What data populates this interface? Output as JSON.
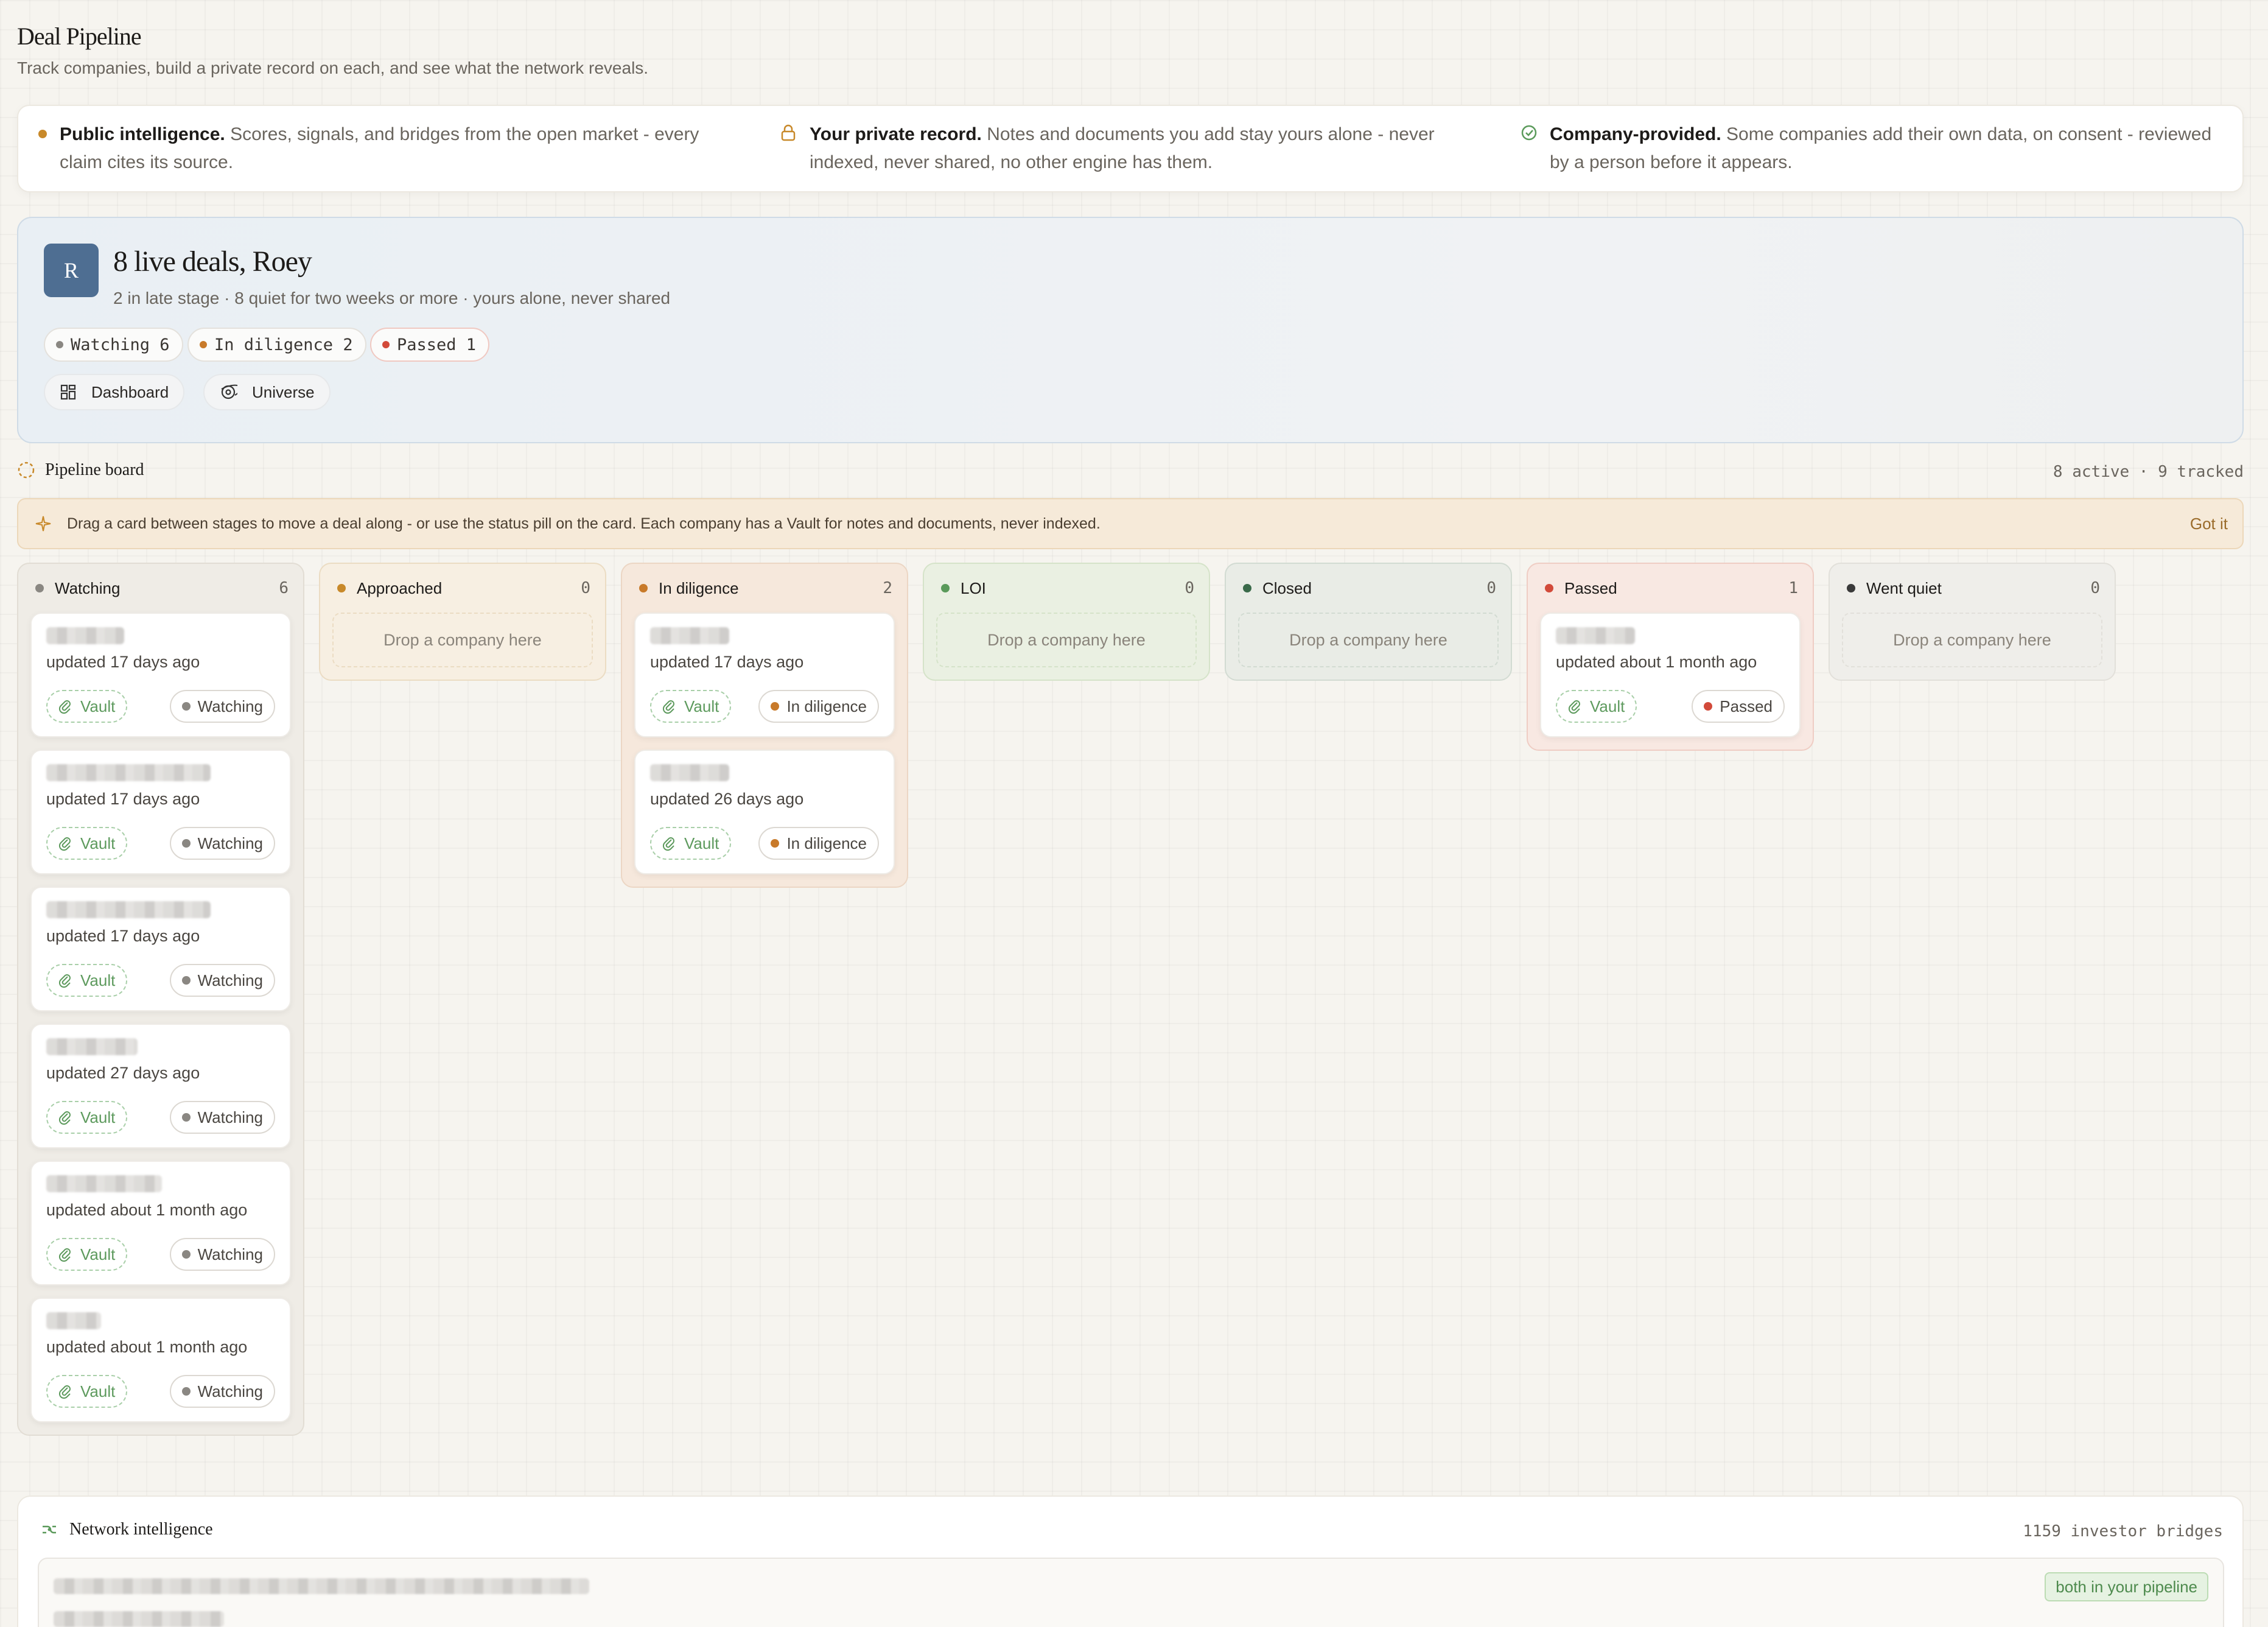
{
  "page": {
    "title": "Deal Pipeline",
    "subtitle": "Track companies, build a private record on each, and see what the network reveals."
  },
  "info": {
    "public": {
      "title": "Public intelligence.",
      "text": " Scores, signals, and bridges from the open market - every claim cites its source."
    },
    "private": {
      "title": "Your private record.",
      "text": " Notes and documents you add stay yours alone - never indexed, never shared, no other engine has them."
    },
    "company": {
      "title": "Company-provided.",
      "text": " Some companies add their own data, on consent - reviewed by a person before it appears."
    }
  },
  "hero": {
    "avatar": "R",
    "title": "8 live deals, Roey",
    "subtitle": "2 in late stage · 8 quiet for two weeks or more · yours alone, never shared",
    "chips": [
      {
        "label": "Watching 6",
        "color": "#8a8782"
      },
      {
        "label": "In diligence 2",
        "color": "#c87a2a"
      },
      {
        "label": "Passed 1",
        "color": "#d24a3a"
      }
    ],
    "buttons": {
      "dashboard": "Dashboard",
      "universe": "Universe"
    }
  },
  "board": {
    "label": "Pipeline board",
    "count": "8 active · 9 tracked",
    "tip": "Drag a card between stages to move a deal along - or use the status pill on the card. Each company has a Vault for notes and documents, never indexed.",
    "tip_dismiss": "Got it",
    "vault_label": "Vault",
    "drop_label": "Drop a company here"
  },
  "columns": [
    {
      "name": "Watching",
      "count": "6",
      "color": "#8a8782",
      "cards": [
        {
          "updated": "updated 17 days ago",
          "status": "Watching"
        },
        {
          "updated": "updated 17 days ago",
          "status": "Watching"
        },
        {
          "updated": "updated 17 days ago",
          "status": "Watching"
        },
        {
          "updated": "updated 27 days ago",
          "status": "Watching"
        },
        {
          "updated": "updated about 1 month ago",
          "status": "Watching"
        },
        {
          "updated": "updated about 1 month ago",
          "status": "Watching"
        }
      ]
    },
    {
      "name": "Approached",
      "count": "0",
      "color": "#c8892a",
      "cards": []
    },
    {
      "name": "In diligence",
      "count": "2",
      "color": "#c87a2a",
      "cards": [
        {
          "updated": "updated 17 days ago",
          "status": "In diligence"
        },
        {
          "updated": "updated 26 days ago",
          "status": "In diligence"
        }
      ]
    },
    {
      "name": "LOI",
      "count": "0",
      "color": "#5a9a5a",
      "cards": []
    },
    {
      "name": "Closed",
      "count": "0",
      "color": "#3a6a4a",
      "cards": []
    },
    {
      "name": "Passed",
      "count": "1",
      "color": "#d24a3a",
      "cards": [
        {
          "updated": "updated about 1 month ago",
          "status": "Passed"
        }
      ]
    },
    {
      "name": "Went quiet",
      "count": "0",
      "color": "#3a3a3a",
      "cards": []
    }
  ],
  "network": {
    "label": "Network intelligence",
    "count": "1159 investor bridges",
    "badge": "both in your pipeline"
  }
}
